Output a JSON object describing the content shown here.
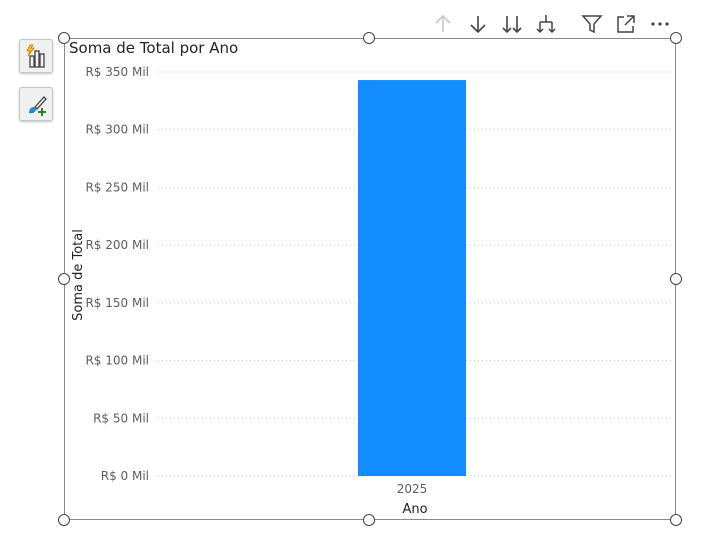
{
  "toolbar": {
    "icons": [
      "drill-up-arrow-icon",
      "drill-down-arrow-icon",
      "expand-all-down-icon",
      "expand-hierarchy-icon",
      "filter-icon",
      "focus-mode-icon",
      "more-options-icon"
    ]
  },
  "side_panel": {
    "icons": [
      "visual-type-icon",
      "format-paintbrush-icon"
    ]
  },
  "colors": {
    "bar": "#118dff",
    "gridline": "#c8c6c4",
    "frame": "#8a8a8a"
  },
  "chart_data": {
    "type": "bar",
    "title": "Soma de Total por Ano",
    "xlabel": "Ano",
    "ylabel": "Soma de Total",
    "categories": [
      "2025"
    ],
    "values": [
      343000
    ],
    "ylim": [
      0,
      350000
    ],
    "yticks": [
      0,
      50000,
      100000,
      150000,
      200000,
      250000,
      300000,
      350000
    ],
    "ytick_labels": [
      "R$ 0 Mil",
      "R$ 50 Mil",
      "R$ 100 Mil",
      "R$ 150 Mil",
      "R$ 200 Mil",
      "R$ 250 Mil",
      "R$ 300 Mil",
      "R$ 350 Mil"
    ],
    "grid": true,
    "legend": "none"
  }
}
